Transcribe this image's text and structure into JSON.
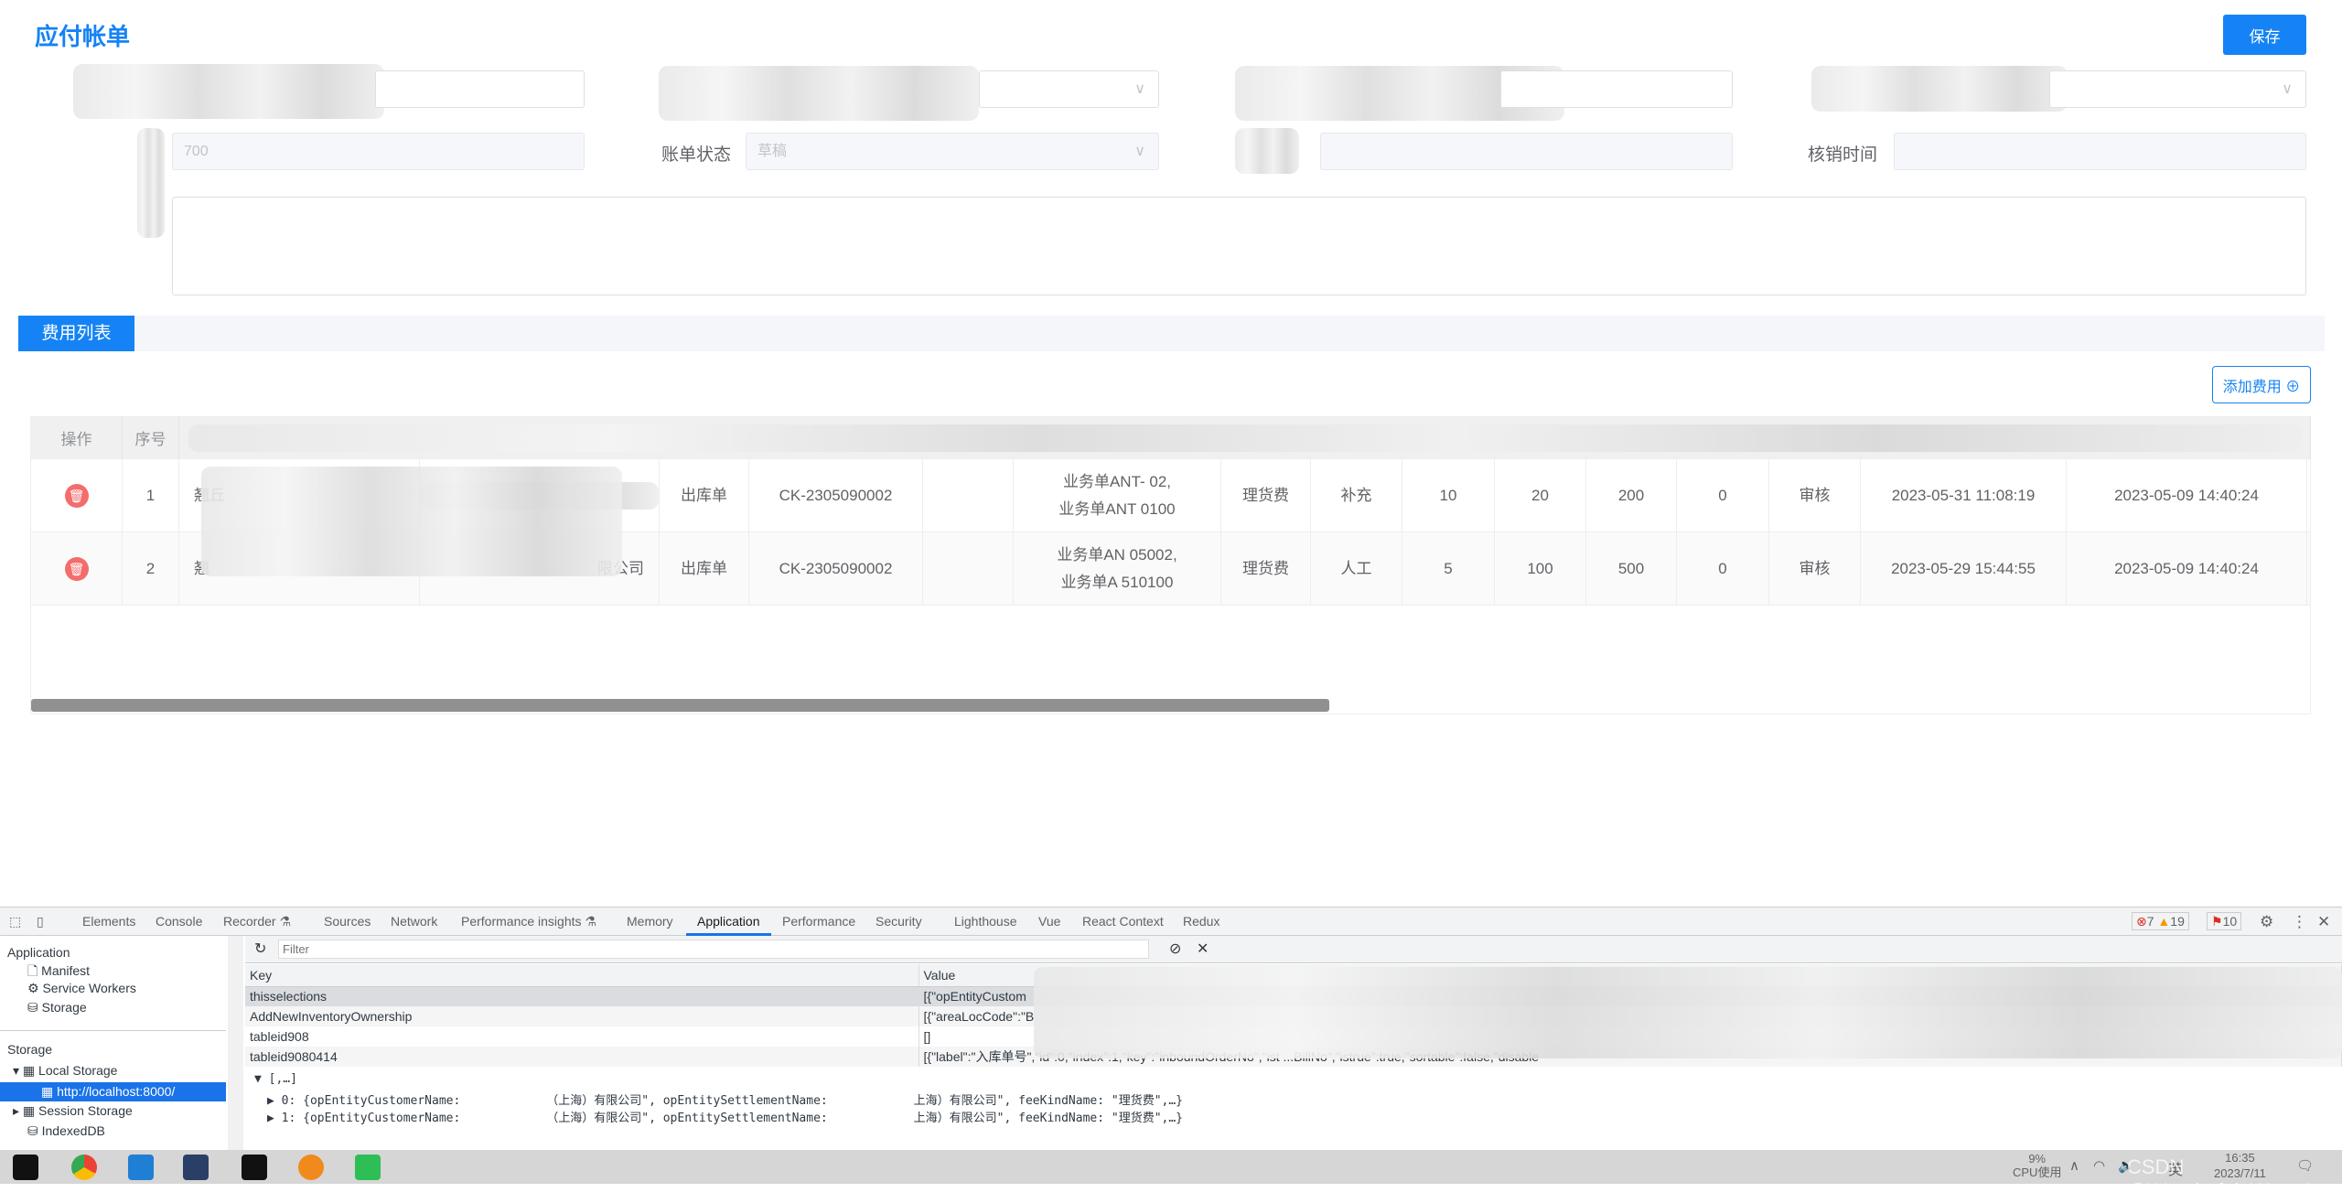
{
  "page": {
    "title": "应付帐单",
    "save_label": "保存"
  },
  "form": {
    "amount_value": "700",
    "status_label": "账单状态",
    "status_value": "草稿",
    "writeoff_label": "核销时间"
  },
  "section": {
    "tab_label": "费用列表",
    "add_label": "添加费用 ⊕"
  },
  "table": {
    "headers": [
      "操作",
      "序号"
    ],
    "rows": [
      {
        "index": "1",
        "col3": "翘丘",
        "col4": "",
        "type": "出库单",
        "no": "CK-2305090002",
        "empty": "",
        "biz1": "业务单ANT-        02,",
        "biz2": "业务单ANT         0100",
        "fee": "理货费",
        "kind": "补充",
        "qty": "10",
        "price": "20",
        "amount": "200",
        "zero": "0",
        "state": "审核",
        "time1": "2023-05-31 11:08:19",
        "time2": "2023-05-09 14:40:24"
      },
      {
        "index": "2",
        "col3": "翘",
        "col4": "限公司",
        "type": "出库单",
        "no": "CK-2305090002",
        "empty": "",
        "biz1": "业务单AN        05002,",
        "biz2": "业务单A         510100",
        "fee": "理货费",
        "kind": "人工",
        "qty": "5",
        "price": "100",
        "amount": "500",
        "zero": "0",
        "state": "审核",
        "time1": "2023-05-29 15:44:55",
        "time2": "2023-05-09 14:40:24"
      }
    ]
  },
  "devtools": {
    "tabs": [
      "Elements",
      "Console",
      "Recorder ⚗",
      "Sources",
      "Network",
      "Performance insights ⚗",
      "Memory",
      "Application",
      "Performance",
      "Security",
      "Lighthouse",
      "Vue",
      "React Context",
      "Redux"
    ],
    "active_tab": "Application",
    "errors": "7",
    "warnings": "19",
    "issues": "10",
    "sidebar": {
      "app_heading": "Application",
      "manifest": "Manifest",
      "service_workers": "Service Workers",
      "storage_item": "Storage",
      "storage_heading": "Storage",
      "local_storage": "Local Storage",
      "origin": "http://localhost:8000/",
      "session_storage": "Session Storage",
      "indexeddb": "IndexedDB"
    },
    "filter_placeholder": "Filter",
    "kv_headers": {
      "key": "Key",
      "value": "Value"
    },
    "kv_rows": [
      {
        "key": "thisselections",
        "value": "[{\"opEntityCustom"
      },
      {
        "key": "AddNewInventoryOwnership",
        "value": "[{\"areaLocCode\":\"B"
      },
      {
        "key": "tableid908",
        "value": "[]"
      },
      {
        "key": "tableid9080414",
        "value": "[{\"label\":\"入库单号\",\"id\":0,\"index\":1,\"key\":\"inboundOrderNo\",\"ist                                  ...BillNo\",\"istrue\":true,\"sortable\":false,\"disable"
      }
    ],
    "preview": {
      "root": "▼ [,…]",
      "item0": "▶ 0: {opEntityCustomerName:            （上海）有限公司\", opEntitySettlementName:            上海）有限公司\", feeKindName: \"理货费\",…}",
      "item1": "▶ 1: {opEntityCustomerName:            （上海）有限公司\", opEntitySettlementName:            上海）有限公司\", feeKindName: \"理货费\",…}"
    }
  },
  "taskbar": {
    "cpu": "9%",
    "cpu_label": "CPU使用",
    "ime": "英",
    "time": "16:35",
    "date": "2023/7/11",
    "watermark": "CSDN @Wonderful_Wang8"
  },
  "colors": {
    "primary": "#1583f5",
    "danger": "#f56c6c",
    "devtools_accent": "#1a73e8"
  }
}
